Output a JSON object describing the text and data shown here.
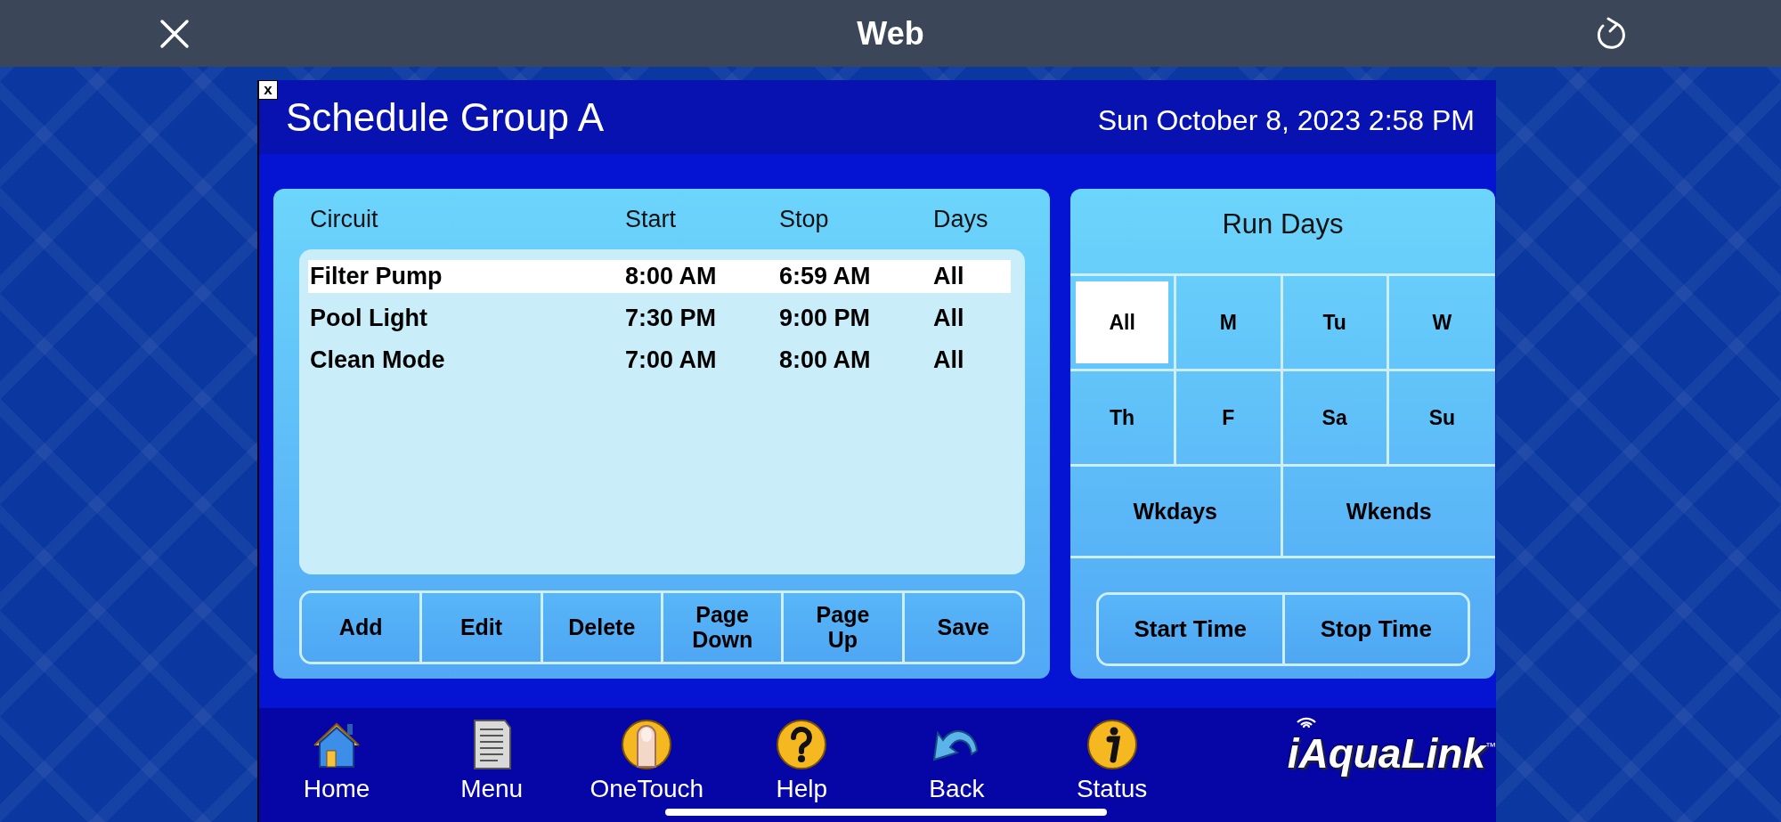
{
  "browser_bar": {
    "title": "Web"
  },
  "screen": {
    "close_label": "x",
    "title": "Schedule Group A",
    "datetime": "Sun October 8, 2023 2:58 PM"
  },
  "schedule": {
    "columns": [
      "Circuit",
      "Start",
      "Stop",
      "Days"
    ],
    "rows": [
      {
        "circuit": "Filter Pump",
        "start": "8:00 AM",
        "stop": "6:59 AM",
        "days": "All",
        "selected": true
      },
      {
        "circuit": "Pool Light",
        "start": "7:30 PM",
        "stop": "9:00 PM",
        "days": "All",
        "selected": false
      },
      {
        "circuit": "Clean Mode",
        "start": "7:00 AM",
        "stop": "8:00 AM",
        "days": "All",
        "selected": false
      }
    ],
    "buttons": [
      "Add",
      "Edit",
      "Delete",
      "Page Down",
      "Page Up",
      "Save"
    ]
  },
  "run_days": {
    "title": "Run Days",
    "days": [
      {
        "label": "All",
        "selected": true
      },
      {
        "label": "M",
        "selected": false
      },
      {
        "label": "Tu",
        "selected": false
      },
      {
        "label": "W",
        "selected": false
      },
      {
        "label": "Th",
        "selected": false
      },
      {
        "label": "F",
        "selected": false
      },
      {
        "label": "Sa",
        "selected": false
      },
      {
        "label": "Su",
        "selected": false
      }
    ],
    "groups": [
      {
        "label": "Wkdays",
        "selected": false
      },
      {
        "label": "Wkends",
        "selected": false
      }
    ],
    "time_buttons": [
      "Start Time",
      "Stop Time"
    ]
  },
  "nav": [
    {
      "label": "Home"
    },
    {
      "label": "Menu"
    },
    {
      "label": "OneTouch"
    },
    {
      "label": "Help"
    },
    {
      "label": "Back"
    },
    {
      "label": "Status"
    }
  ],
  "logo": {
    "name": "iAquaLink",
    "mark": "™"
  }
}
